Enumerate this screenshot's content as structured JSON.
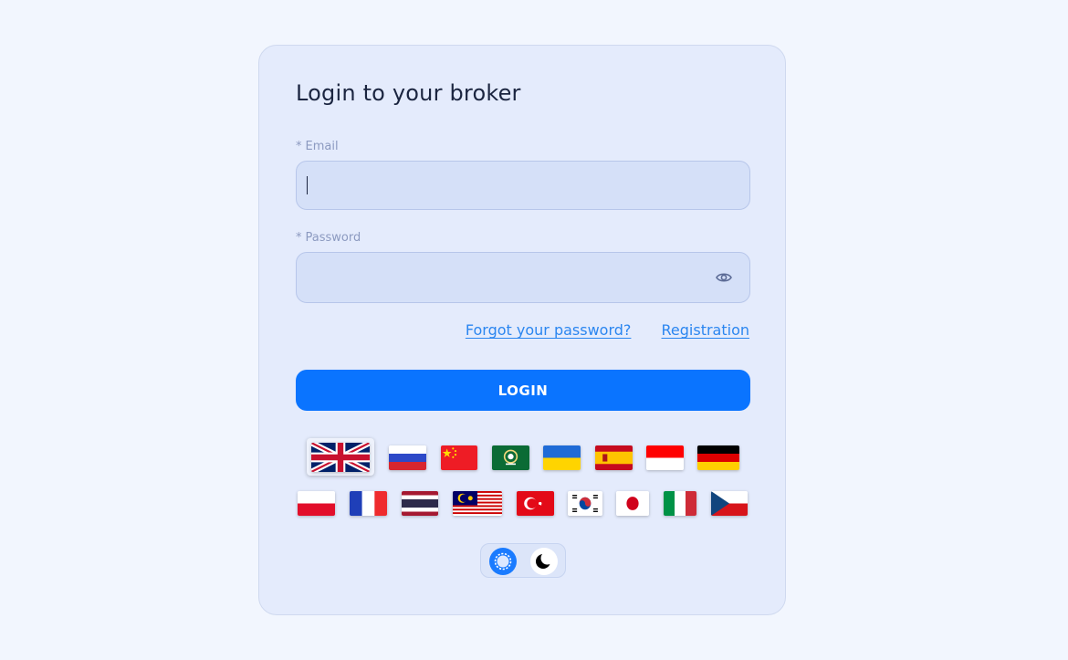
{
  "login": {
    "title": "Login to your broker",
    "required_marker": "*",
    "email_label": "Email",
    "email_value": "",
    "password_label": "Password",
    "password_value": "",
    "forgot_link": "Forgot your password?",
    "registration_link": "Registration",
    "login_button": "LOGIN"
  },
  "languages": {
    "selected": "English",
    "flags": [
      "English",
      "Russian",
      "Chinese",
      "Arabic",
      "Ukrainian",
      "Spanish",
      "Indonesian",
      "German",
      "Polish",
      "French",
      "Thai",
      "Malay",
      "Turkish",
      "Korean",
      "Japanese",
      "Italian",
      "Czech"
    ]
  },
  "theme": {
    "active": "light",
    "icons": [
      "sun-icon",
      "moon-icon"
    ]
  },
  "colors": {
    "accent": "#0a74ff",
    "link": "#2b86f0",
    "page_background": "#f2f6fe",
    "card_background": "#e4ebfc",
    "input_background": "#d5e0f8"
  }
}
